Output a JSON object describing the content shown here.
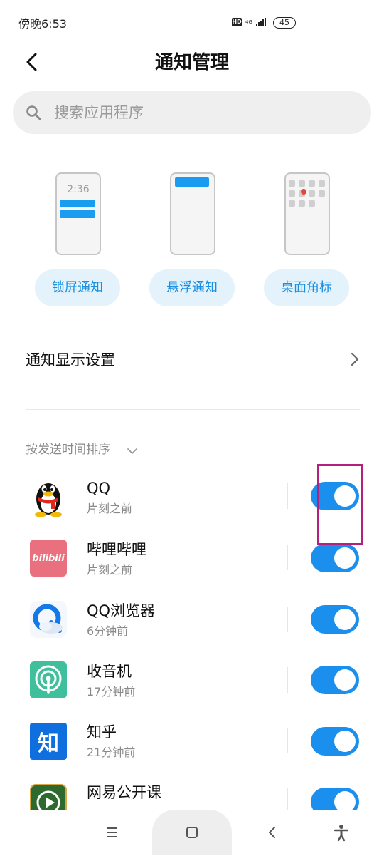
{
  "status_bar": {
    "time": "傍晚6:53",
    "hd_badge": "HD",
    "network": "4G",
    "battery": "45"
  },
  "header": {
    "title": "通知管理"
  },
  "search": {
    "placeholder": "搜索应用程序"
  },
  "notification_styles": [
    {
      "label": "锁屏通知",
      "preview_time": "2:36"
    },
    {
      "label": "悬浮通知"
    },
    {
      "label": "桌面角标"
    }
  ],
  "settings_row": {
    "label": "通知显示设置"
  },
  "sort": {
    "label": "按发送时间排序"
  },
  "apps": [
    {
      "name": "QQ",
      "time": "片刻之前",
      "enabled": true
    },
    {
      "name": "哔哩哔哩",
      "time": "片刻之前",
      "enabled": true,
      "icon_text": "bilibili"
    },
    {
      "name": "QQ浏览器",
      "time": "6分钟前",
      "enabled": true
    },
    {
      "name": "收音机",
      "time": "17分钟前",
      "enabled": true
    },
    {
      "name": "知乎",
      "time": "21分钟前",
      "enabled": true,
      "icon_text": "知"
    },
    {
      "name": "网易公开课",
      "time": "",
      "enabled": true
    }
  ],
  "colors": {
    "accent": "#1a8fee",
    "pill_bg": "#e3f2fb",
    "highlight": "#b3207e"
  }
}
